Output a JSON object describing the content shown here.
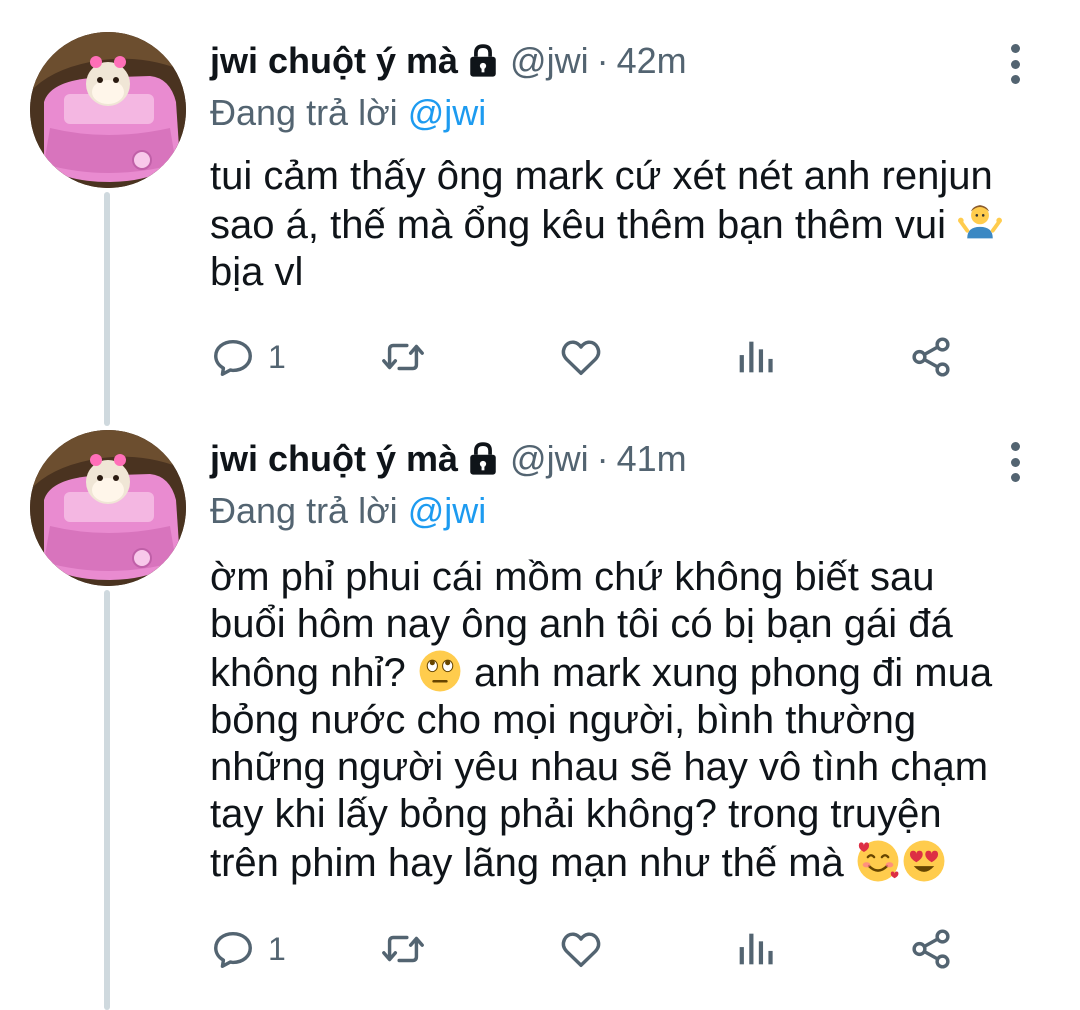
{
  "tweets": [
    {
      "name": "jwi chuột ý mà",
      "handle": "@jwi",
      "separator": "·",
      "time": "42m",
      "reply_prefix": "Đang trả lời",
      "reply_handle": "@jwi",
      "text_lines": [
        "tui cảm thấy ông mark cứ xét nét anh renjun",
        "sao á, thế mà ổng kêu thêm bạn thêm vui",
        "bịa vl"
      ],
      "emojis": [
        "person-shrugging-emoji"
      ],
      "reply_count": "1"
    },
    {
      "name": "jwi chuột ý mà",
      "handle": "@jwi",
      "separator": "·",
      "time": "41m",
      "reply_prefix": "Đang trả lời",
      "reply_handle": "@jwi",
      "text_lines": [
        "ờm phỉ phui cái mồm chứ không biết sau",
        "buổi hôm nay ông anh tôi có bị bạn gái đá",
        "không nhỉ?",
        "anh mark xung phong đi mua",
        "bỏng nước cho mọi người, bình thường",
        "những người yêu nhau sẽ hay vô tình chạm",
        "tay khi lấy bỏng phải không? trong truyện",
        "trên phim hay lãng mạn như thế mà"
      ],
      "emojis": [
        "face-rolling-eyes-emoji",
        "smiling-face-with-hearts-emoji",
        "heart-eyes-emoji"
      ],
      "reply_count": "1"
    }
  ],
  "icons": {
    "lock": "lock-icon",
    "more": "more-vertical-icon",
    "reply": "reply-icon",
    "retweet": "retweet-icon",
    "like": "like-icon",
    "views": "views-icon",
    "share": "share-icon"
  },
  "colors": {
    "text": "#0f1419",
    "secondary": "#536471",
    "mention": "#1d9bf0",
    "thread_line": "#cfd9de"
  }
}
